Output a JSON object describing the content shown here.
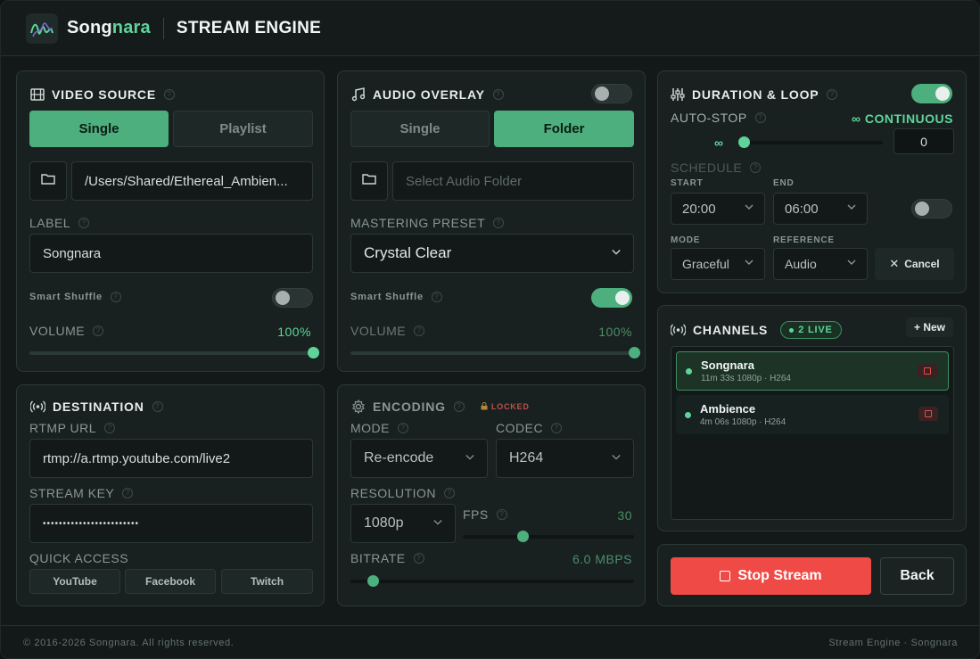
{
  "header": {
    "brand_main": "Song",
    "brand_accent": "nara",
    "title": "STREAM ENGINE"
  },
  "video_source": {
    "title": "VIDEO SOURCE",
    "tab_single": "Single",
    "tab_playlist": "Playlist",
    "path": "/Users/Shared/Ethereal_Ambien...",
    "label_title": "LABEL",
    "label_value": "Songnara",
    "shuffle_label": "Smart Shuffle",
    "shuffle_on": false,
    "volume_label": "VOLUME",
    "volume_value": "100%",
    "volume_level": 1.0
  },
  "audio_overlay": {
    "title": "AUDIO OVERLAY",
    "enabled": false,
    "tab_single": "Single",
    "tab_folder": "Folder",
    "folder_placeholder": "Select Audio Folder",
    "mastering_label": "MASTERING PRESET",
    "mastering_value": "Crystal Clear",
    "shuffle_label": "Smart Shuffle",
    "shuffle_on": true,
    "volume_label": "VOLUME",
    "volume_value": "100%",
    "volume_level": 1.0
  },
  "duration": {
    "title": "DURATION & LOOP",
    "enabled": true,
    "autostop_label": "AUTO-STOP",
    "continuous_label": "∞ CONTINUOUS",
    "infinity": "∞",
    "autostop_value": "0",
    "schedule_label": "SCHEDULE",
    "start_label": "START",
    "start_value": "20:00",
    "end_label": "END",
    "end_value": "06:00",
    "schedule_enabled": false,
    "mode_label": "MODE",
    "mode_value": "Graceful",
    "reference_label": "REFERENCE",
    "reference_value": "Audio",
    "cancel_label": "Cancel"
  },
  "destination": {
    "title": "DESTINATION",
    "rtmp_label": "RTMP URL",
    "rtmp_value": "rtmp://a.rtmp.youtube.com/live2",
    "key_label": "STREAM KEY",
    "key_value": "••••••••••••••••••••••••",
    "quick_label": "QUICK ACCESS",
    "quick_youtube": "YouTube",
    "quick_facebook": "Facebook",
    "quick_twitch": "Twitch"
  },
  "encoding": {
    "title": "ENCODING",
    "locked_label": "LOCKED",
    "mode_label": "MODE",
    "mode_value": "Re-encode",
    "codec_label": "CODEC",
    "codec_value": "H264",
    "resolution_label": "RESOLUTION",
    "resolution_value": "1080p",
    "fps_label": "FPS",
    "fps_value": "30",
    "fps_level": 0.35,
    "bitrate_label": "BITRATE",
    "bitrate_value": "6.0 MBPS",
    "bitrate_level": 0.08
  },
  "channels": {
    "title": "CHANNELS",
    "live_badge": "2 LIVE",
    "new_label": "+ New",
    "items": [
      {
        "name": "Songnara",
        "meta": "11m 33s  1080p · H264"
      },
      {
        "name": "Ambience",
        "meta": "4m 06s  1080p · H264"
      }
    ]
  },
  "actions": {
    "stop_label": "Stop Stream",
    "back_label": "Back"
  },
  "footer": {
    "copyright": "© 2016-2026 Songnara. All rights reserved.",
    "right": "Stream Engine · Songnara"
  },
  "colors": {
    "accent": "#4caf7d",
    "accent_text": "#5fd49a",
    "danger": "#f04a47",
    "background": "#121918"
  }
}
